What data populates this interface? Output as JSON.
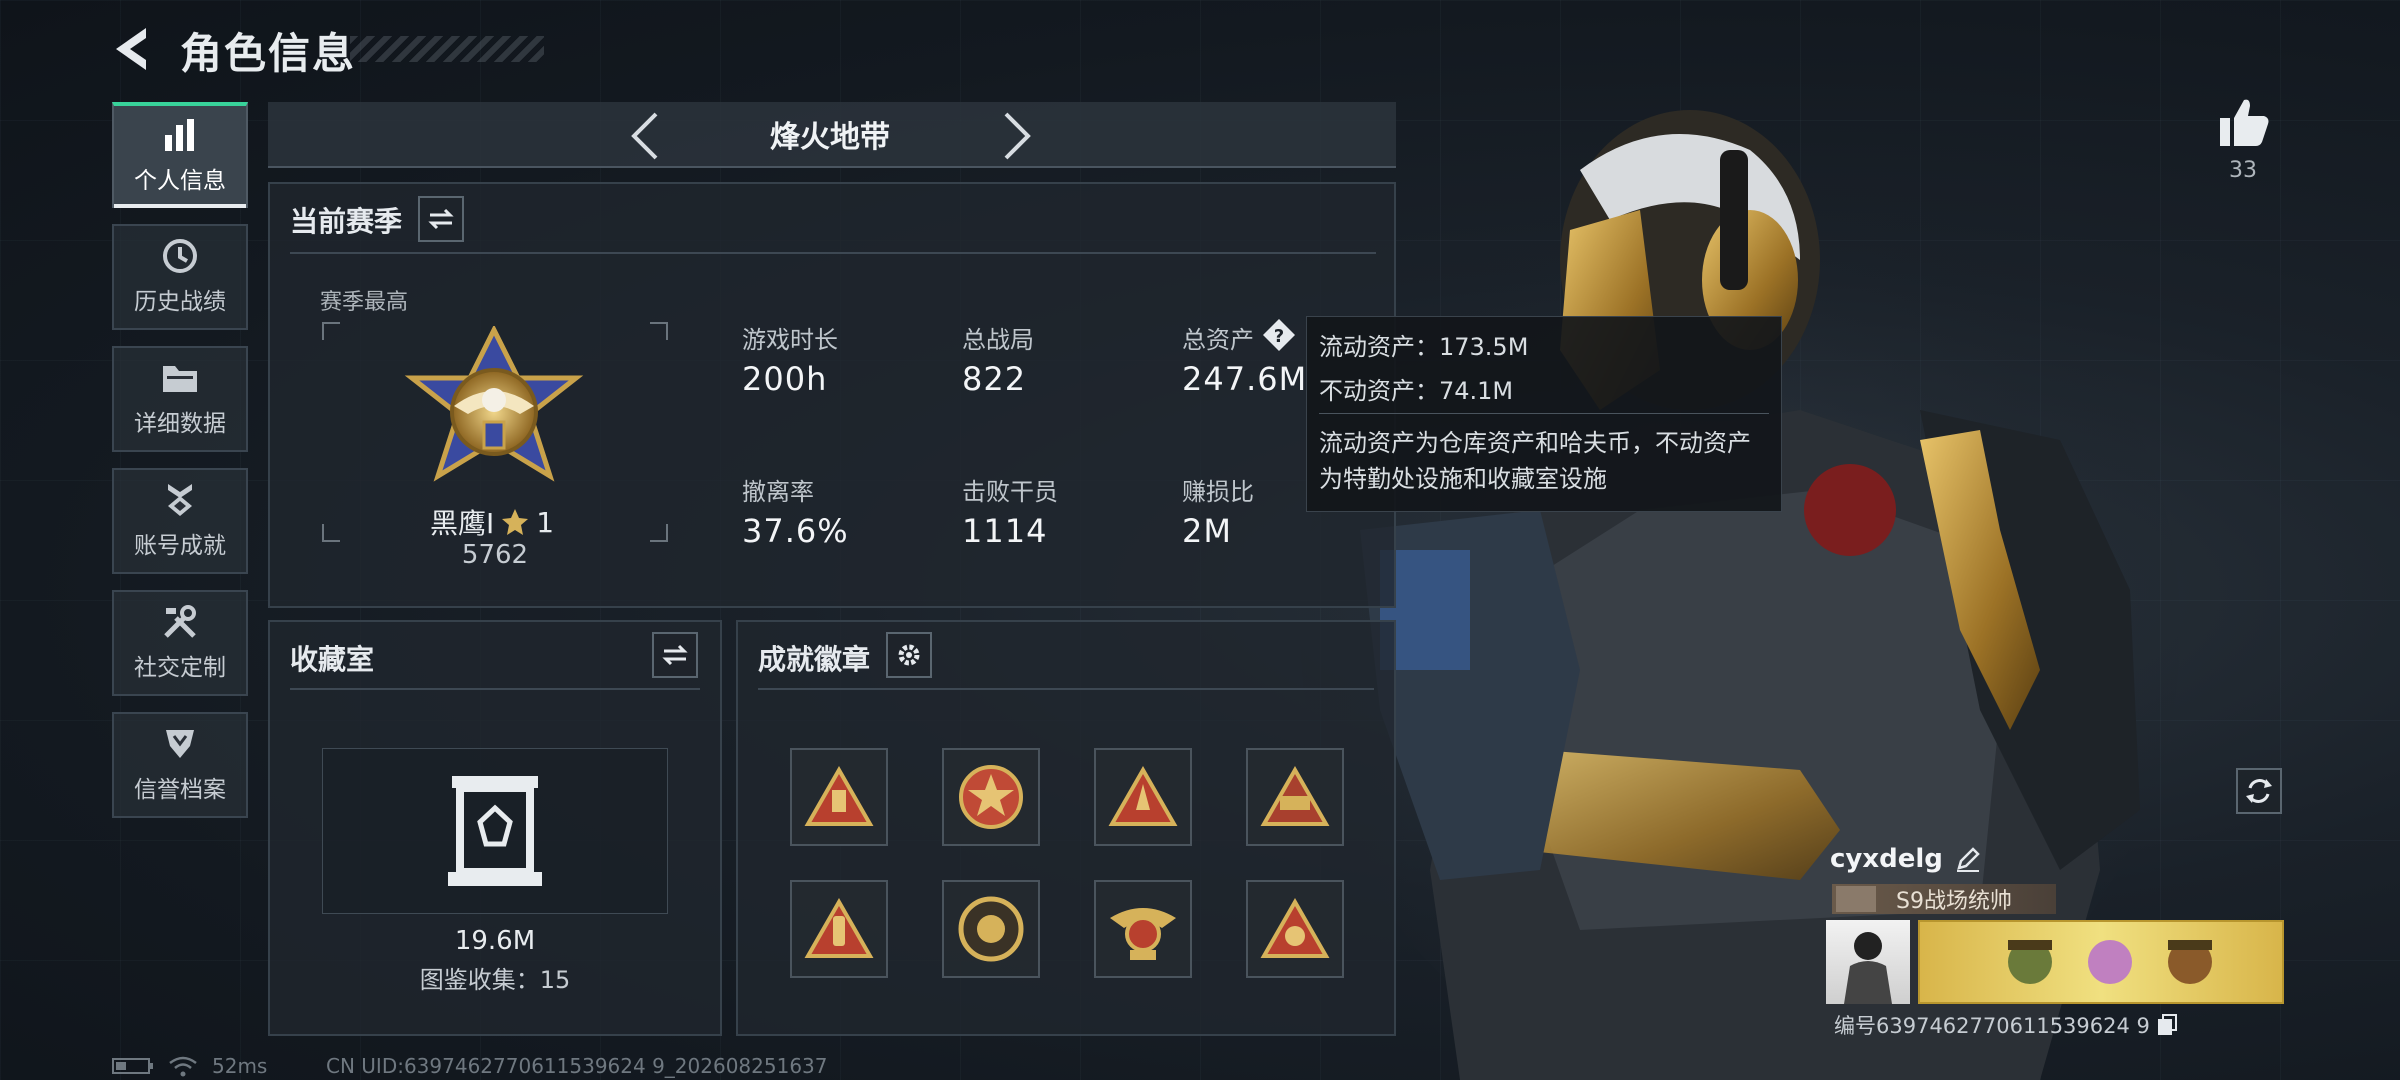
{
  "header": {
    "title": "角色信息"
  },
  "sidebar": {
    "items": [
      {
        "label": "个人信息",
        "icon": "bar-chart-icon",
        "active": true
      },
      {
        "label": "历史战绩",
        "icon": "history-clock-icon",
        "active": false
      },
      {
        "label": "详细数据",
        "icon": "folder-icon",
        "active": false
      },
      {
        "label": "账号成就",
        "icon": "achievement-medal-icon",
        "active": false
      },
      {
        "label": "社交定制",
        "icon": "tools-icon",
        "active": false
      },
      {
        "label": "信誉档案",
        "icon": "shield-badge-icon",
        "active": false
      }
    ]
  },
  "mode": {
    "label": "烽火地带"
  },
  "season": {
    "title": "当前赛季",
    "best_label": "赛季最高",
    "rank_name": "黑鹰I",
    "rank_stars": "1",
    "rank_score": "5762",
    "stats": [
      {
        "label": "游戏时长",
        "value": "200h"
      },
      {
        "label": "总战局",
        "value": "822"
      },
      {
        "label": "总资产",
        "value": "247.6M"
      },
      {
        "label": "撤离率",
        "value": "37.6%"
      },
      {
        "label": "击败干员",
        "value": "1114"
      },
      {
        "label": "赚损比",
        "value": "2M"
      }
    ]
  },
  "tooltip": {
    "liquid": "流动资产：173.5M",
    "fixed": "不动资产：74.1M",
    "desc_line1": "流动资产为仓库资产和哈夫币，不动资产",
    "desc_line2": "为特勤处设施和收藏室设施"
  },
  "collection": {
    "title": "收藏室",
    "value": "19.6M",
    "count_label": "图鉴收集：15"
  },
  "achievements": {
    "title": "成就徽章",
    "badges": [
      {
        "icon": "triangle-badge-icon",
        "color": "#b8402e"
      },
      {
        "icon": "star-medal-icon",
        "color": "#c04a36"
      },
      {
        "icon": "rocket-triangle-icon",
        "color": "#b8402e"
      },
      {
        "icon": "s9-triangle-icon",
        "color": "#c9a24a"
      },
      {
        "icon": "bottle-triangle-icon",
        "color": "#b8402e"
      },
      {
        "icon": "round-emblem-icon",
        "color": "#c9a24a"
      },
      {
        "icon": "eagle-emblem-icon",
        "color": "#c9a24a"
      },
      {
        "icon": "mech-triangle-icon",
        "color": "#b8402e"
      }
    ]
  },
  "profile": {
    "likes": "33",
    "username": "cyxdelg",
    "title_tag": "S9战场统帅",
    "id_line": "编号6397462770611539624 9"
  },
  "footer": {
    "ping": "52ms",
    "uid": "CN UID:6397462770611539624 9_202608251637"
  },
  "colors": {
    "accent_green": "#38d39a",
    "gold": "#c9a24a"
  }
}
